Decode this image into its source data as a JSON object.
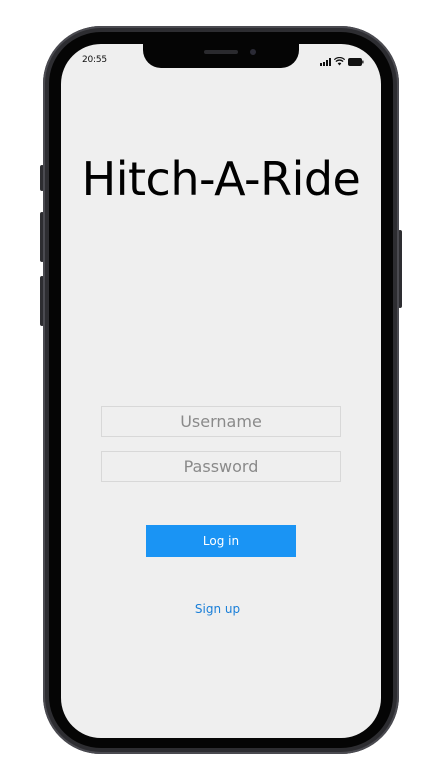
{
  "status_bar": {
    "time": "20:55",
    "icons": [
      "signal-icon",
      "wifi-icon",
      "battery-icon"
    ]
  },
  "app": {
    "title": "Hitch-A-Ride"
  },
  "login_form": {
    "username_placeholder": "Username",
    "username_value": "",
    "password_placeholder": "Password",
    "password_value": "",
    "login_label": "Log in",
    "signup_label": "Sign up"
  },
  "colors": {
    "accent": "#1a94f4",
    "link": "#1a7fd8",
    "screen_background": "#efefef",
    "frame": "#2d2d31"
  }
}
